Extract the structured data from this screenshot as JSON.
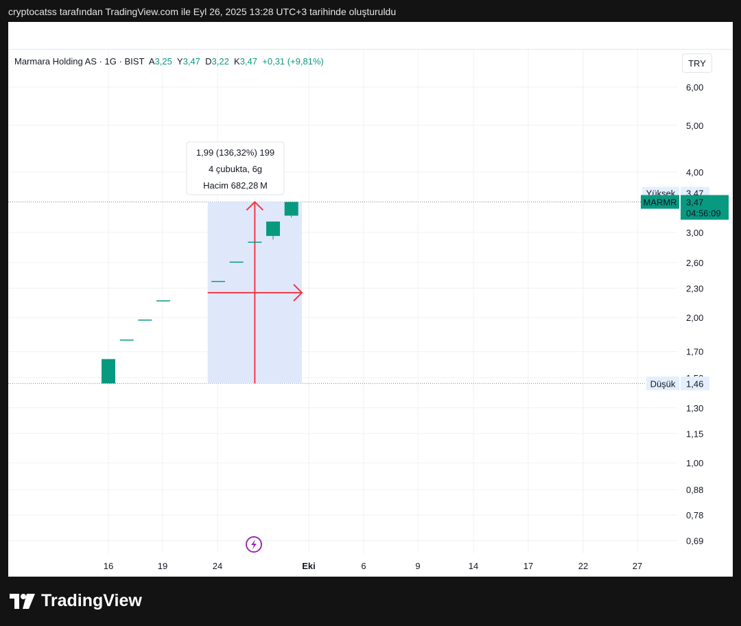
{
  "caption": "cryptocatss tarafından TradingView.com ile Eyl 26, 2025 13:28 UTC+3 tarihinde oluşturuldu",
  "legend": {
    "name": "Marmara Holding AS",
    "sep1": "·",
    "interval": "1G",
    "sep2": "·",
    "exchange": "BIST",
    "open_label": "A",
    "open": "3,25",
    "high_label": "Y",
    "high": "3,47",
    "low_label": "D",
    "low": "3,22",
    "close_label": "K",
    "close": "3,47",
    "change": "+0,31 (+9,81%)"
  },
  "currency": "TRY",
  "tooltip": {
    "line1": "1,99 (136,32%) 199",
    "line2": "4 çubukta, 6g",
    "line3": "Hacim 682,28 M"
  },
  "markers": {
    "high_label": "Yüksek",
    "high_value": "3,47",
    "symbol": "MARMR",
    "last_price": "3,47",
    "countdown": "04:56:09",
    "low_label": "Düşük",
    "low_value": "1,46"
  },
  "brand": "TradingView",
  "colors": {
    "up": "#089981",
    "measure_arrow": "#f23645",
    "measure_fill": "#dfe8fb",
    "grid": "#eef0f3",
    "marker_bg": "#e3effd",
    "event_icon": "#9c27b0"
  },
  "chart_data": {
    "type": "candlestick",
    "y_scale": "log",
    "y_ticks": [
      "6,00",
      "5,00",
      "4,00",
      "3,00",
      "2,60",
      "2,30",
      "2,00",
      "1,70",
      "1,50",
      "1,30",
      "1,15",
      "1,00",
      "0,88",
      "0,78",
      "0,69"
    ],
    "x_ticks": [
      "16",
      "19",
      "24",
      "Eki",
      "6",
      "9",
      "14",
      "17",
      "22",
      "27"
    ],
    "candles": [
      {
        "date": "2025-09-16",
        "open": 1.46,
        "high": 1.64,
        "low": 1.46,
        "close": 1.64
      },
      {
        "date": "2025-09-17",
        "open": 1.8,
        "high": 1.8,
        "low": 1.8,
        "close": 1.8
      },
      {
        "date": "2025-09-18",
        "open": 1.98,
        "high": 1.98,
        "low": 1.98,
        "close": 1.98
      },
      {
        "date": "2025-09-19",
        "open": 2.17,
        "high": 2.17,
        "low": 2.17,
        "close": 2.17
      },
      {
        "date": "2025-09-22",
        "open": 2.38,
        "high": 2.38,
        "low": 2.38,
        "close": 2.38
      },
      {
        "date": "2025-09-23",
        "open": 2.61,
        "high": 2.61,
        "low": 2.61,
        "close": 2.61
      },
      {
        "date": "2025-09-24",
        "open": 2.87,
        "high": 2.87,
        "low": 2.87,
        "close": 2.87
      },
      {
        "date": "2025-09-25",
        "open": 2.95,
        "high": 3.16,
        "low": 2.9,
        "close": 3.16
      },
      {
        "date": "2025-09-26",
        "open": 3.25,
        "high": 3.47,
        "low": 3.22,
        "close": 3.47
      }
    ],
    "price_lines": {
      "high": 3.47,
      "low": 1.46
    },
    "measure": {
      "from_date": "2025-09-22",
      "to_date": "2025-09-26",
      "from_price": 1.46,
      "to_price": 3.47
    }
  }
}
